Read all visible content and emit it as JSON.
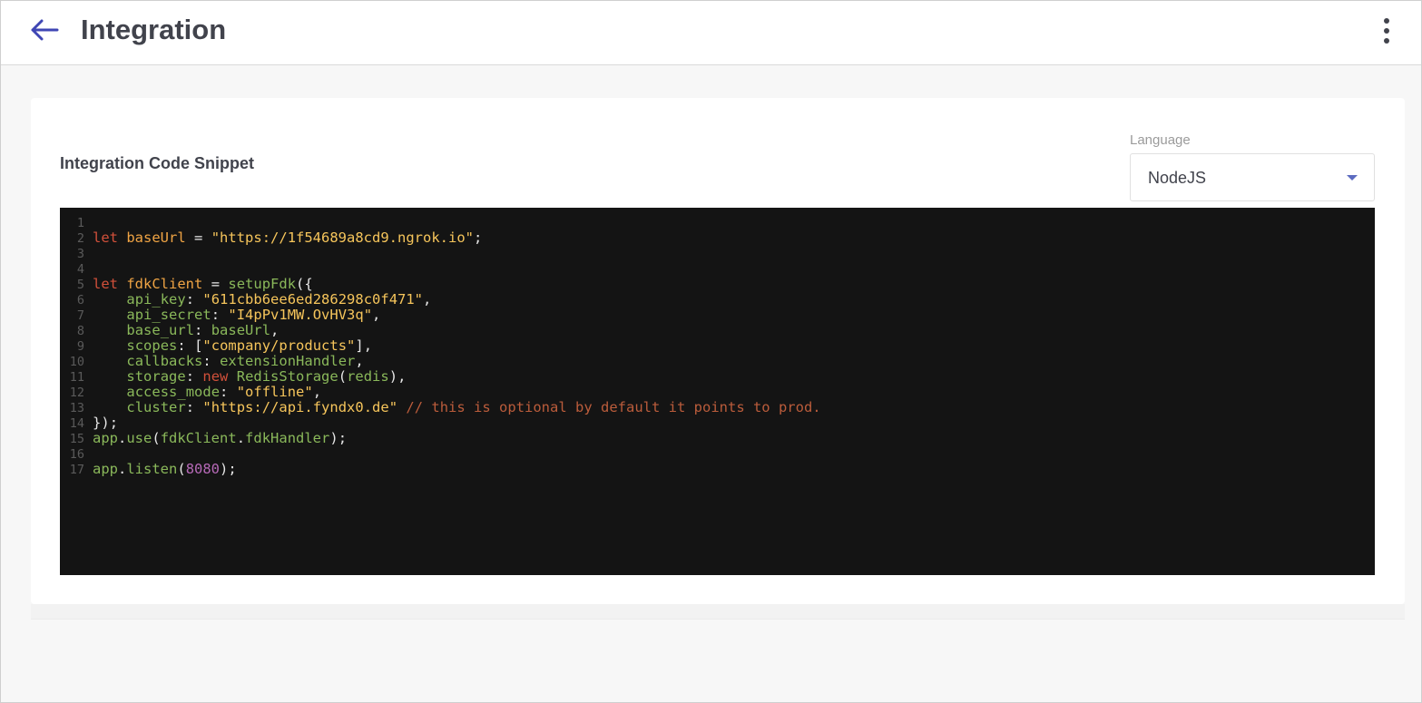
{
  "header": {
    "title": "Integration"
  },
  "card": {
    "section_title": "Integration Code Snippet",
    "language": {
      "label": "Language",
      "selected": "NodeJS"
    }
  },
  "code": {
    "line_numbers": [
      "1",
      "2",
      "3",
      "4",
      "5",
      "6",
      "7",
      "8",
      "9",
      "10",
      "11",
      "12",
      "13",
      "14",
      "15",
      "16",
      "17"
    ],
    "lines": [
      "",
      "let baseUrl = \"https://1f54689a8cd9.ngrok.io\";",
      "",
      "",
      "let fdkClient = setupFdk({",
      "    api_key: \"611cbb6ee6ed286298c0f471\",",
      "    api_secret: \"I4pPv1MW.OvHV3q\",",
      "    base_url: baseUrl,",
      "    scopes: [\"company/products\"],",
      "    callbacks: extensionHandler,",
      "    storage: new RedisStorage(redis),",
      "    access_mode: \"offline\",",
      "    cluster: \"https://api.fyndx0.de\" // this is optional by default it points to prod.",
      "});",
      "app.use(fdkClient.fdkHandler);",
      "",
      "app.listen(8080);"
    ]
  },
  "icons": {
    "back": "arrow-left-icon",
    "menu": "more-vertical-icon",
    "dropdown": "caret-down-icon"
  },
  "colors": {
    "accent": "#3f46b4",
    "editor_bg": "#141414",
    "title_text": "#41434c"
  }
}
